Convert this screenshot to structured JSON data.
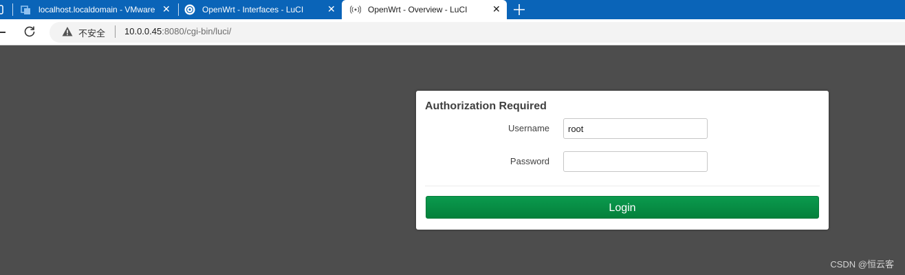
{
  "browser": {
    "tabs": [
      {
        "title": "localhost.localdomain - VMware",
        "close": "✕"
      },
      {
        "title": "OpenWrt - Interfaces - LuCI",
        "close": "✕"
      },
      {
        "title": "OpenWrt - Overview - LuCI",
        "close": "✕",
        "active": true
      }
    ],
    "new_tab_icon": "plus-icon",
    "reload_icon": "reload-icon",
    "security_label": "不安全",
    "url_host": "10.0.0.45",
    "url_rest": ":8080/cgi-bin/luci/",
    "colors": {
      "tabstrip": "#0a64b8",
      "page_bg": "#4d4d4d",
      "login_button": "#04803b"
    }
  },
  "login": {
    "title": "Authorization Required",
    "username_label": "Username",
    "username_value": "root",
    "password_label": "Password",
    "password_value": "",
    "button_label": "Login"
  },
  "watermark": "CSDN @恒云客"
}
